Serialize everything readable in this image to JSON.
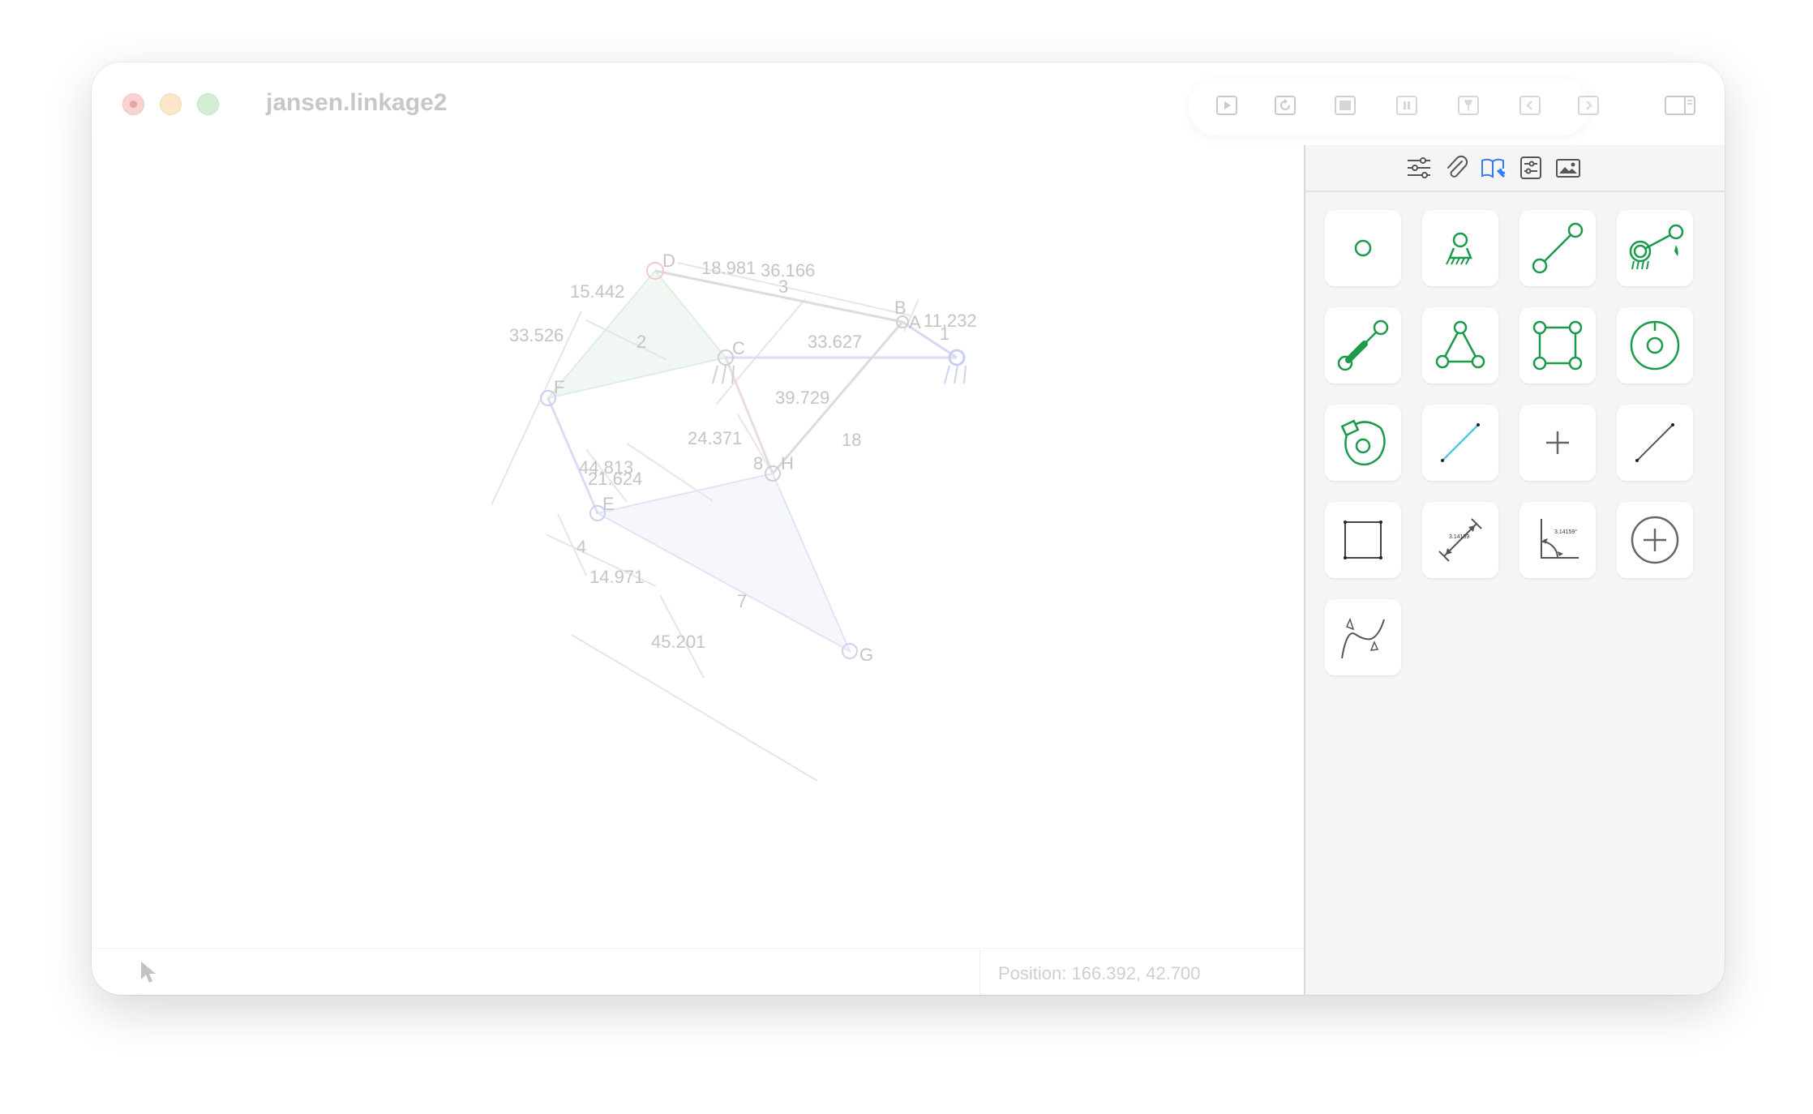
{
  "window": {
    "title": "jansen.linkage2"
  },
  "toolbar": {
    "buttons": [
      {
        "name": "run",
        "icon": "play-icon"
      },
      {
        "name": "rotate",
        "icon": "rotate-icon"
      },
      {
        "name": "stop",
        "icon": "stop-icon"
      },
      {
        "name": "pause",
        "icon": "pause-icon"
      },
      {
        "name": "pin",
        "icon": "pin-icon"
      },
      {
        "name": "previous",
        "icon": "chevron-left-icon"
      },
      {
        "name": "next",
        "icon": "chevron-right-icon"
      },
      {
        "name": "toggle-sidebar",
        "icon": "sidebar-icon"
      }
    ]
  },
  "sidebar": {
    "tabs": [
      {
        "name": "settings",
        "icon": "sliders-icon"
      },
      {
        "name": "attachments",
        "icon": "paperclip-icon"
      },
      {
        "name": "library",
        "icon": "book-tool-icon",
        "selected": true
      },
      {
        "name": "properties",
        "icon": "properties-icon"
      },
      {
        "name": "image",
        "icon": "image-icon"
      }
    ],
    "accent_color": "#1a9a4a",
    "selected_tab_color": "#2f7cf6",
    "tools": [
      {
        "name": "connector",
        "icon": "connector-icon"
      },
      {
        "name": "anchor",
        "icon": "anchor-icon"
      },
      {
        "name": "link",
        "icon": "link-icon"
      },
      {
        "name": "input-crank",
        "icon": "input-crank-icon"
      },
      {
        "name": "actuator",
        "icon": "actuator-icon"
      },
      {
        "name": "triangle",
        "icon": "triangle-link-icon"
      },
      {
        "name": "rectangle",
        "icon": "rectangle-link-icon"
      },
      {
        "name": "gear",
        "icon": "gear-icon"
      },
      {
        "name": "cam",
        "icon": "cam-icon"
      },
      {
        "name": "line-element",
        "icon": "blue-line-icon"
      },
      {
        "name": "point",
        "icon": "plus-point-icon"
      },
      {
        "name": "line",
        "icon": "line-icon"
      },
      {
        "name": "rectangle-shape",
        "icon": "rectangle-icon"
      },
      {
        "name": "measurement",
        "icon": "dimension-icon",
        "label": "3.14159"
      },
      {
        "name": "angle",
        "icon": "angle-icon",
        "label": "3.14159°"
      },
      {
        "name": "circle-add",
        "icon": "circle-plus-icon"
      },
      {
        "name": "curve",
        "icon": "curve-icon"
      }
    ]
  },
  "canvas": {
    "connectors": [
      "A",
      "B",
      "C",
      "D",
      "E",
      "F",
      "G",
      "H"
    ],
    "link_labels": [
      "1",
      "2",
      "3",
      "7",
      "8",
      "18",
      "4"
    ],
    "dimensions": [
      "18.981",
      "36.166",
      "15.442",
      "33.526",
      "11.232",
      "33.627",
      "39.729",
      "24.371",
      "44.813",
      "21.624",
      "14.971",
      "45.201"
    ]
  },
  "status": {
    "position_text": "Position: 166.392, 42.700"
  }
}
